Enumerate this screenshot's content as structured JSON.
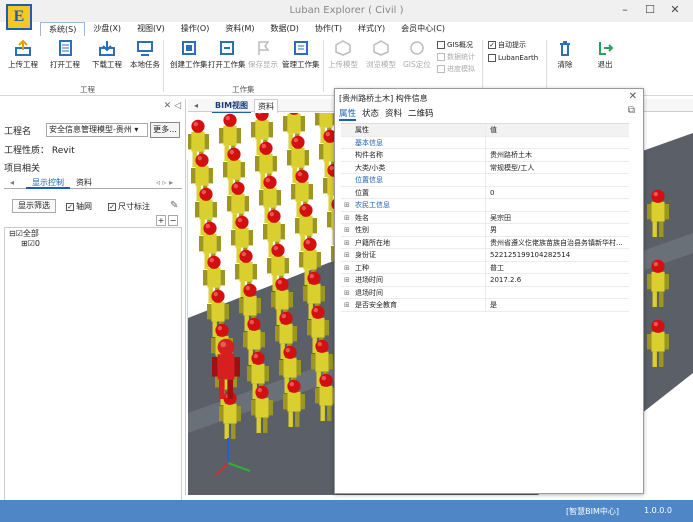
{
  "window": {
    "title": "Luban Explorer ( Civil )",
    "logo_letter": "E"
  },
  "menus": [
    "系统(S)",
    "沙盘(X)",
    "视图(V)",
    "操作(O)",
    "资料(M)",
    "数据(D)",
    "协作(T)",
    "样式(Y)",
    "会员中心(C)"
  ],
  "ribbon": {
    "project_buttons": [
      "上传工程",
      "打开工程",
      "下载工程",
      "本地任务"
    ],
    "project_group": "工程",
    "workset_buttons": [
      "创建工作集",
      "打开工作集",
      "保存显示",
      "管理工作集"
    ],
    "workset_group": "工作集",
    "model_buttons": [
      "上传模型",
      "浏览模型",
      "GIS定位"
    ],
    "gis_items": [
      "GIS概况",
      "数据统计",
      "进度模拟"
    ],
    "auto_tip": "自动提示",
    "luban_earth": "LubanEarth",
    "clear": "清除",
    "exit": "退出"
  },
  "left_panel": {
    "project_label": "工程名",
    "project_value": "安全信息管理模型-贵州",
    "more": "更多...",
    "project_type": "工程性质：  Revit",
    "related": "项目相关",
    "tabs": [
      "显示控制",
      "资料"
    ],
    "filter": "显示筛选",
    "axis": "轴网",
    "dimension": "尺寸标注",
    "tree": [
      "全部",
      "0"
    ]
  },
  "viewport": {
    "tabs": [
      "BIM视图",
      "资料"
    ]
  },
  "dialog": {
    "title": "[贵州路桥土木] 构件信息",
    "tabs": [
      "属性",
      "状态",
      "资料",
      "二维码"
    ],
    "header": [
      "属性",
      "值"
    ],
    "rows": [
      {
        "k": "基本信息",
        "v": "",
        "cat": true
      },
      {
        "k": "构件名称",
        "v": "贵州路桥土木"
      },
      {
        "k": "大类/小类",
        "v": "常规模型/工人"
      },
      {
        "k": "位置信息",
        "v": "",
        "cat": true
      },
      {
        "k": "位置",
        "v": "0"
      },
      {
        "k": "农民工信息",
        "v": "",
        "cat": true,
        "exp": true
      },
      {
        "k": "姓名",
        "v": "吴宗田",
        "exp": true
      },
      {
        "k": "性别",
        "v": "男",
        "exp": true
      },
      {
        "k": "户籍所在地",
        "v": "贵州省遵义仡佬族苗族自治县务镇新华村...",
        "exp": true
      },
      {
        "k": "身份证",
        "v": "522125199104282514",
        "exp": true
      },
      {
        "k": "工种",
        "v": "普工",
        "exp": true
      },
      {
        "k": "进场时间",
        "v": "2017.2.6",
        "exp": true
      },
      {
        "k": "退场时间",
        "v": "",
        "exp": true
      },
      {
        "k": "是否安全教育",
        "v": "是",
        "exp": true
      }
    ]
  },
  "status": {
    "center": "[智慧BIM中心]",
    "version": "1.0.0.0"
  }
}
